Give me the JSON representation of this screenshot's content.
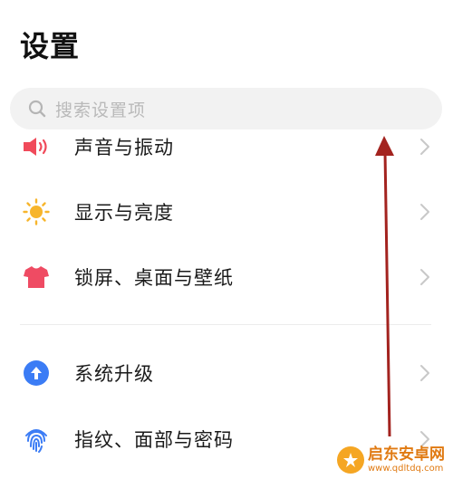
{
  "header": {
    "title": "设置"
  },
  "search": {
    "placeholder": "搜索设置项",
    "icon": "search-icon"
  },
  "settings": {
    "items": [
      {
        "label": "声音与振动",
        "icon": "speaker-icon",
        "icon_color": "#f04a5a"
      },
      {
        "label": "显示与亮度",
        "icon": "sun-icon",
        "icon_color": "#f7b52c"
      },
      {
        "label": "锁屏、桌面与壁纸",
        "icon": "tshirt-icon",
        "icon_color": "#ef4b63"
      },
      {
        "label": "系统升级",
        "icon": "upgrade-icon",
        "icon_color": "#3b7cf5"
      },
      {
        "label": "指纹、面部与密码",
        "icon": "fingerprint-icon",
        "icon_color": "#3b7cf5"
      }
    ]
  },
  "annotation": {
    "arrow_color": "#a3231f"
  },
  "watermark": {
    "title": "启东安卓网",
    "url": "www.qdltdq.com",
    "color": "#e07a12"
  }
}
